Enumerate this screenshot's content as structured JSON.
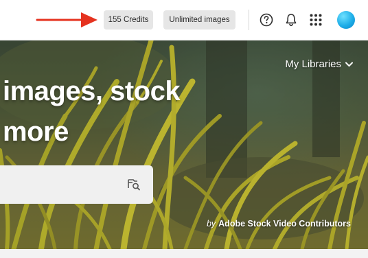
{
  "header": {
    "credits_label": "155 Credits",
    "unlimited_label": "Unlimited images",
    "icons": [
      "help-icon",
      "bell-icon",
      "app-switcher-icon"
    ],
    "annotation_arrow_color": "#e5321f"
  },
  "hero": {
    "libraries_label": "My Libraries",
    "headline_line1": "images, stock",
    "headline_line2": "more",
    "credit_by": "by",
    "credit_name": "Adobe Stock Video Contributors"
  },
  "colors": {
    "pill_bg": "#e6e6e6",
    "avatar": "#1eaee8"
  }
}
